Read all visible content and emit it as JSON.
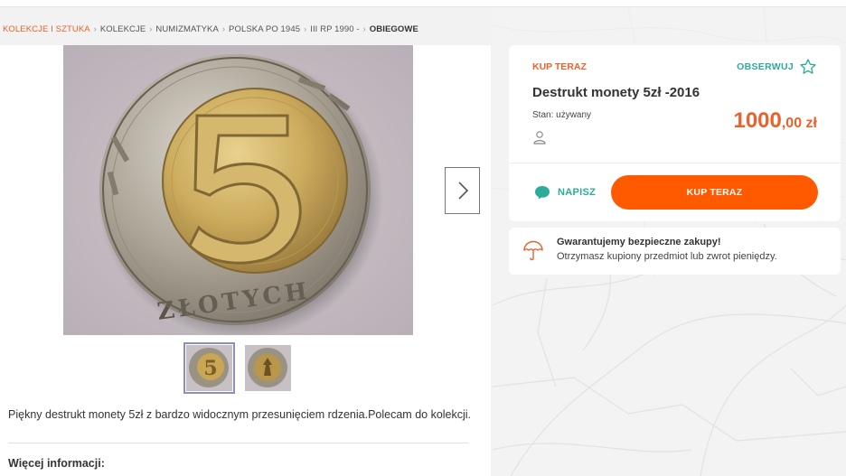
{
  "breadcrumb": [
    "KOLEKCJE I SZTUKA",
    "KOLEKCJE",
    "NUMIZMATYKA",
    "POLSKA PO 1945",
    "III RP 1990 -",
    "OBIEGOWE"
  ],
  "gallery": {
    "thumbnails": [
      "5-zlotych-obverse",
      "5-zlotych-reverse"
    ],
    "active_index": 0,
    "coin_lettering": "ZŁOTYCH",
    "coin_numeral": "5"
  },
  "listing": {
    "buy_now_label": "KUP TERAZ",
    "watch_label": "OBSERWUJ",
    "title": "Destrukt monety 5zł -2016",
    "condition": "Stan: używany",
    "price_int": "1000",
    "price_dec": ",00 zł",
    "write_label": "NAPISZ",
    "buy_button_label": "KUP TERAZ"
  },
  "guarantee": {
    "title": "Gwarantujemy bezpieczne zakupy!",
    "text": "Otrzymasz kupiony przedmiot lub zwrot pieniędzy."
  },
  "description": "Piękny destrukt monety 5zł z bardzo widocznym przesunięciem rdzenia.Polecam do kolekcji.",
  "more_info_label": "Więcej informacji:",
  "colors": {
    "accent_orange": "#ff5a00",
    "label_orange": "#e8632b",
    "teal": "#2cab9a"
  }
}
